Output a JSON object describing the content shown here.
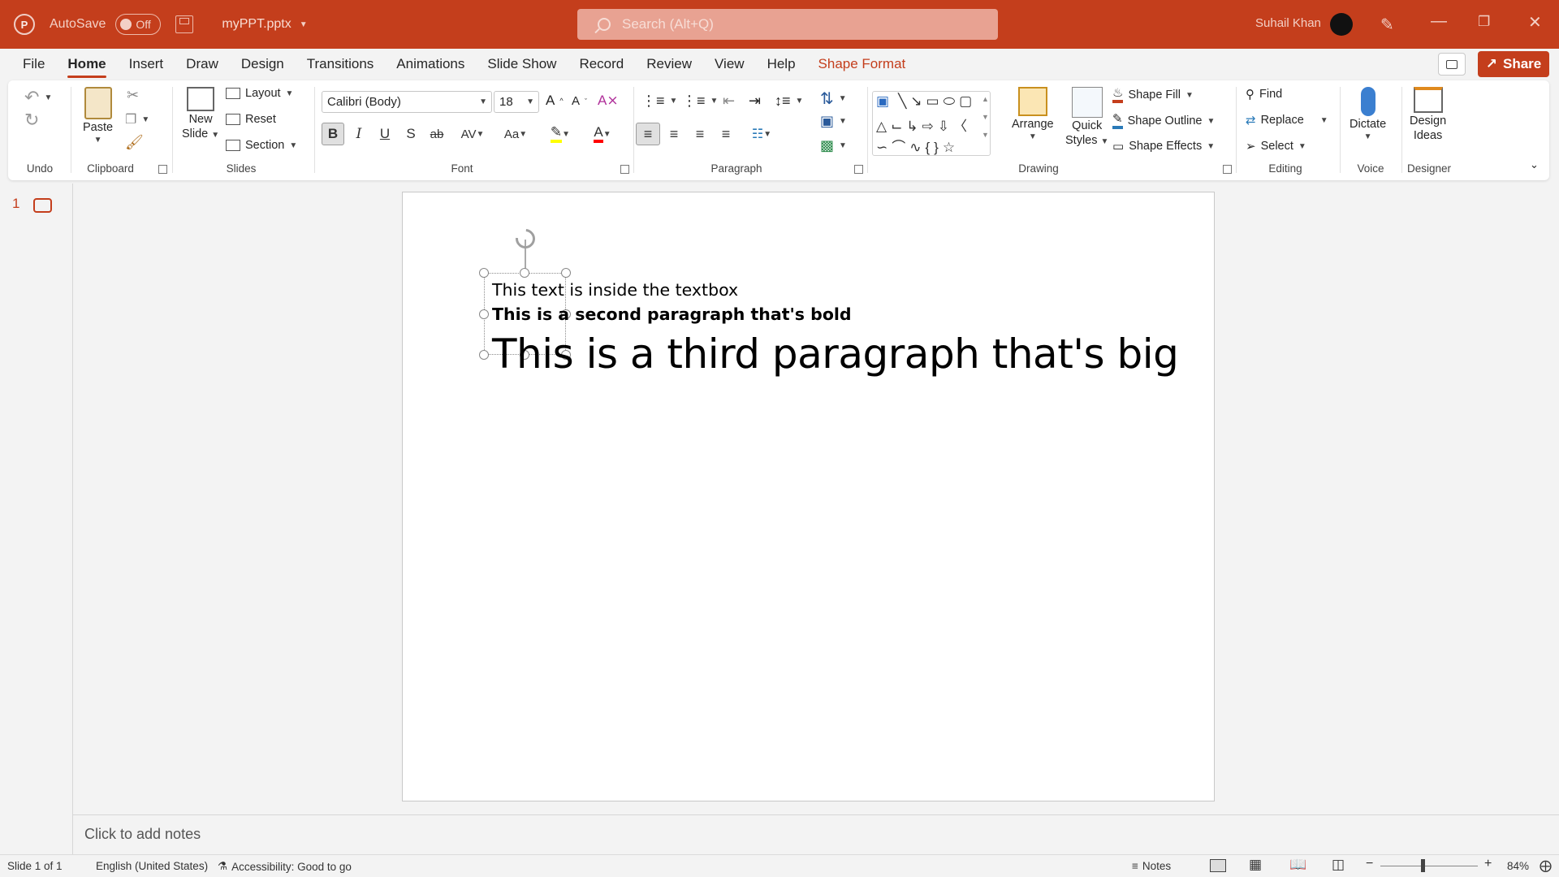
{
  "titlebar": {
    "logo": "P",
    "autosave_label": "AutoSave",
    "autosave_state": "Off",
    "filename": "myPPT.pptx",
    "search_placeholder": "Search (Alt+Q)",
    "user_name": "Suhail Khan"
  },
  "menu": {
    "tabs": [
      "File",
      "Home",
      "Insert",
      "Draw",
      "Design",
      "Transitions",
      "Animations",
      "Slide Show",
      "Record",
      "Review",
      "View",
      "Help",
      "Shape Format"
    ],
    "active": "Home",
    "share_label": "Share"
  },
  "ribbon": {
    "groups": {
      "undo": "Undo",
      "clipboard": "Clipboard",
      "slides": "Slides",
      "font": "Font",
      "paragraph": "Paragraph",
      "drawing": "Drawing",
      "editing": "Editing",
      "voice": "Voice",
      "designer": "Designer"
    },
    "paste": "Paste",
    "new_slide": [
      "New",
      "Slide"
    ],
    "layout": "Layout",
    "reset": "Reset",
    "section": "Section",
    "font_name": "Calibri (Body)",
    "font_size": "18",
    "arrange": "Arrange",
    "quick_styles": [
      "Quick",
      "Styles"
    ],
    "shape_fill": "Shape Fill",
    "shape_outline": "Shape Outline",
    "shape_effects": "Shape Effects",
    "find": "Find",
    "replace": "Replace",
    "select": "Select",
    "dictate": "Dictate",
    "design_ideas": [
      "Design",
      "Ideas"
    ],
    "colors": {
      "highlight": "#ffff00",
      "font_color": "#ff0000",
      "accent": "#c43e1c"
    }
  },
  "thumbnails": {
    "slide_number": "1"
  },
  "slide": {
    "paragraphs": [
      "This text is inside the textbox",
      "This is a second paragraph that's bold",
      "This is a third paragraph that's big"
    ]
  },
  "notes_placeholder": "Click to add notes",
  "statusbar": {
    "slide_info": "Slide 1 of 1",
    "language": "English (United States)",
    "accessibility": "Accessibility: Good to go",
    "notes": "Notes",
    "zoom": "84%"
  }
}
